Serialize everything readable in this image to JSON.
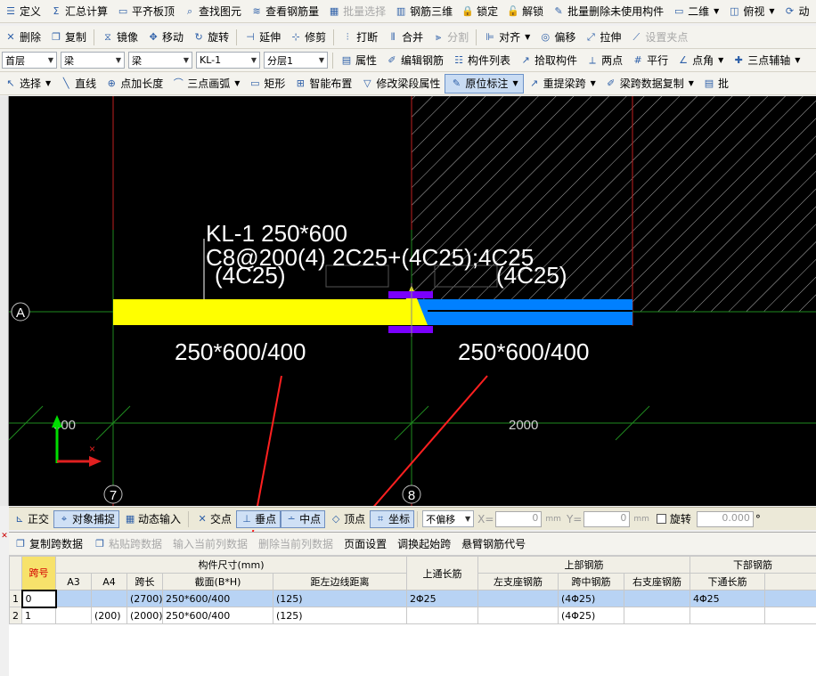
{
  "toolbar1": {
    "items": [
      {
        "label": "定义",
        "icon": "define-icon"
      },
      {
        "label": "汇总计算",
        "icon": "sigma-icon"
      },
      {
        "label": "平齐板顶",
        "icon": "align-slab-icon"
      },
      {
        "label": "查找图元",
        "icon": "binoculars-icon"
      },
      {
        "label": "查看钢筋量",
        "icon": "rebar-qty-icon"
      },
      {
        "label": "批量选择",
        "icon": "batch-select-icon",
        "disabled": true
      },
      {
        "label": "钢筋三维",
        "icon": "rebar-3d-icon"
      },
      {
        "label": "锁定",
        "icon": "lock-icon"
      },
      {
        "label": "解锁",
        "icon": "unlock-icon"
      },
      {
        "label": "批量删除未使用构件",
        "icon": "batch-delete-icon"
      },
      {
        "label": "二维",
        "icon": "2d-icon"
      },
      {
        "label": "俯视",
        "icon": "top-view-icon"
      },
      {
        "label": "动",
        "icon": "dynamic-view-icon"
      }
    ]
  },
  "toolbar2": {
    "items": [
      {
        "label": "删除",
        "icon": "delete-icon"
      },
      {
        "label": "复制",
        "icon": "copy-icon"
      },
      {
        "label": "镜像",
        "icon": "mirror-icon"
      },
      {
        "label": "移动",
        "icon": "move-icon"
      },
      {
        "label": "旋转",
        "icon": "rotate-icon"
      },
      {
        "label": "延伸",
        "icon": "extend-icon"
      },
      {
        "label": "修剪",
        "icon": "trim-icon"
      },
      {
        "label": "打断",
        "icon": "break-icon"
      },
      {
        "label": "合并",
        "icon": "merge-icon"
      },
      {
        "label": "分割",
        "icon": "split-icon",
        "disabled": true
      },
      {
        "label": "对齐",
        "icon": "align-icon"
      },
      {
        "label": "偏移",
        "icon": "offset-icon"
      },
      {
        "label": "拉伸",
        "icon": "stretch-icon"
      },
      {
        "label": "设置夹点",
        "icon": "grip-icon",
        "disabled": true
      }
    ]
  },
  "toolbar3": {
    "floor": "首层",
    "category": "梁",
    "type": "梁",
    "component": "KL-1",
    "layer": "分层1",
    "items": [
      {
        "label": "属性",
        "icon": "properties-icon"
      },
      {
        "label": "编辑钢筋",
        "icon": "edit-rebar-icon"
      },
      {
        "label": "构件列表",
        "icon": "list-icon"
      },
      {
        "label": "拾取构件",
        "icon": "pick-icon"
      },
      {
        "label": "两点",
        "icon": "two-point-icon"
      },
      {
        "label": "平行",
        "icon": "parallel-icon"
      },
      {
        "label": "点角",
        "icon": "point-angle-icon"
      },
      {
        "label": "三点辅轴",
        "icon": "three-point-axis-icon"
      }
    ]
  },
  "toolbar4": {
    "items": [
      {
        "label": "选择",
        "icon": "select-cursor-icon"
      },
      {
        "label": "直线",
        "icon": "line-icon"
      },
      {
        "label": "点加长度",
        "icon": "point-length-icon"
      },
      {
        "label": "三点画弧",
        "icon": "arc-icon"
      },
      {
        "label": "矩形",
        "icon": "rectangle-icon"
      },
      {
        "label": "智能布置",
        "icon": "smart-layout-icon"
      },
      {
        "label": "修改梁段属性",
        "icon": "modify-segment-icon"
      },
      {
        "label": "原位标注",
        "icon": "in-place-annotation-icon",
        "active": true
      },
      {
        "label": "重提梁跨",
        "icon": "re-extract-span-icon"
      },
      {
        "label": "梁跨数据复制",
        "icon": "span-copy-icon"
      },
      {
        "label": "批",
        "icon": "batch-icon"
      }
    ]
  },
  "canvas": {
    "beam_label_name": "KL-1 250*600",
    "beam_label_rebar": "C8@200(4) 2C25+(4C25);4C25",
    "left_bottom_anno": "(4C25)",
    "right_bottom_anno": "(4C25)",
    "left_section": "250*600/400",
    "right_section": "250*600/400",
    "axis_row": "A",
    "axis_left": "7",
    "axis_right": "8",
    "dim_left": "900",
    "dim_right": "2000",
    "colors": {
      "background": "#000000",
      "left_beam": "#ffff00",
      "right_beam": "#0080ff",
      "grid": "#1f8a1f",
      "column_marker": "#7a00ff",
      "arrow": "#ff2020"
    }
  },
  "statusbar": {
    "items": [
      {
        "label": "正交",
        "icon": "ortho-icon"
      },
      {
        "label": "对象捕捉",
        "icon": "snap-icon",
        "pressed": true
      },
      {
        "label": "动态输入",
        "icon": "dynamic-input-icon"
      },
      {
        "label": "交点",
        "icon": "intersection-icon"
      },
      {
        "label": "垂点",
        "icon": "perpendicular-icon",
        "pressed": true
      },
      {
        "label": "中点",
        "icon": "midpoint-icon",
        "pressed": true
      },
      {
        "label": "顶点",
        "icon": "vertex-icon"
      },
      {
        "label": "坐标",
        "icon": "coordinate-icon",
        "pressed": true
      }
    ],
    "offset_mode": "不偏移",
    "x_label": "X=",
    "x_value": "0",
    "y_label": "Y=",
    "y_value": "0",
    "unit": "mm",
    "rotate_label": "旋转",
    "rotate_value": "0.000",
    "degree": "°"
  },
  "panel": {
    "tools": [
      {
        "label": "复制跨数据",
        "disabled": false
      },
      {
        "label": "粘贴跨数据",
        "disabled": true
      },
      {
        "label": "输入当前列数据",
        "disabled": true
      },
      {
        "label": "删除当前列数据",
        "disabled": true
      },
      {
        "label": "页面设置",
        "disabled": false
      },
      {
        "label": "调换起始跨",
        "disabled": false
      },
      {
        "label": "悬臂钢筋代号",
        "disabled": false
      }
    ],
    "headers": {
      "span": "跨号",
      "dims_group": "构件尺寸(mm)",
      "a3": "A3",
      "a4": "A4",
      "span_len": "跨长",
      "section": "截面(B*H)",
      "edge_dist": "距左边线距离",
      "top_through": "上通长筋",
      "top_group": "上部钢筋",
      "left_seat": "左支座钢筋",
      "mid_span": "跨中钢筋",
      "right_seat": "右支座钢筋",
      "bottom_group": "下部钢筋",
      "bottom_through": "下通长筋"
    },
    "rows": [
      {
        "num": "1",
        "span": "0",
        "a3": "",
        "a4": "",
        "span_len": "(2700)",
        "section": "250*600/400",
        "edge_dist": "(125)",
        "top_through": "2Φ25",
        "left_seat": "",
        "mid_span": "(4Φ25)",
        "right_seat": "",
        "bottom_through": "4Φ25"
      },
      {
        "num": "2",
        "span": "1",
        "a3": "",
        "a4": "(200)",
        "span_len": "(2000)",
        "section": "250*600/400",
        "edge_dist": "(125)",
        "top_through": "",
        "left_seat": "",
        "mid_span": "(4Φ25)",
        "right_seat": "",
        "bottom_through": ""
      }
    ]
  }
}
